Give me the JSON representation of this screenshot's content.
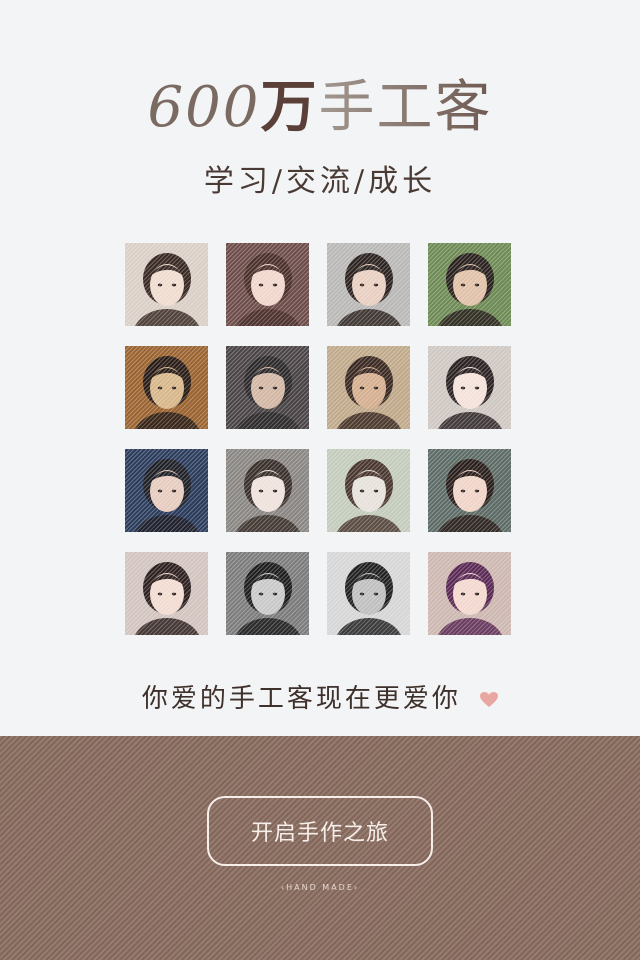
{
  "header": {
    "count": "600",
    "unit": "万",
    "name": "手工客",
    "subtitle": "学习/交流/成长"
  },
  "grid": {
    "avatars": [
      {
        "label": "avatar-1",
        "bg": "#d9cfc6",
        "skin": "#f0dccf",
        "hair": "#3a2a24"
      },
      {
        "label": "avatar-2",
        "bg": "#6d4d4a",
        "skin": "#f1d6cc",
        "hair": "#4b302b"
      },
      {
        "label": "avatar-3",
        "bg": "#b9b8b6",
        "skin": "#e8cfc1",
        "hair": "#2d2422"
      },
      {
        "label": "avatar-4",
        "bg": "#6e8a55",
        "skin": "#e1c1a8",
        "hair": "#2a221f"
      },
      {
        "label": "avatar-5",
        "bg": "#9a6330",
        "skin": "#d7b68a",
        "hair": "#2a1d17"
      },
      {
        "label": "avatar-6",
        "bg": "#4b4446",
        "skin": "#d3b7a5",
        "hair": "#2d2a2b"
      },
      {
        "label": "avatar-7",
        "bg": "#c0a98a",
        "skin": "#d4ae8e",
        "hair": "#3b2a22"
      },
      {
        "label": "avatar-8",
        "bg": "#cfc7c2",
        "skin": "#f4e2da",
        "hair": "#2b2324"
      },
      {
        "label": "avatar-9",
        "bg": "#2b3c5c",
        "skin": "#e6cbbf",
        "hair": "#202028"
      },
      {
        "label": "avatar-10",
        "bg": "#8a8683",
        "skin": "#efe2dc",
        "hair": "#3a302c"
      },
      {
        "label": "avatar-11",
        "bg": "#c3ccbc",
        "skin": "#e6e1da",
        "hair": "#4a3830"
      },
      {
        "label": "avatar-12",
        "bg": "#5d6b66",
        "skin": "#f0d4c7",
        "hair": "#2a1f1b"
      },
      {
        "label": "avatar-13",
        "bg": "#d2c4bf",
        "skin": "#f2dbd1",
        "hair": "#2e2120"
      },
      {
        "label": "avatar-14",
        "bg": "#7c7c7c",
        "skin": "#c9c9c9",
        "hair": "#1e1e1e"
      },
      {
        "label": "avatar-15",
        "bg": "#d6d6d6",
        "skin": "#bfbfbf",
        "hair": "#222222"
      },
      {
        "label": "avatar-16",
        "bg": "#cdb7b0",
        "skin": "#f3d8cf",
        "hair": "#5a2a55"
      }
    ]
  },
  "tagline": "你爱的手工客现在更爱你",
  "heart_icon": "heart-icon",
  "cta": {
    "label": "开启手作之旅"
  },
  "brandmark": "HAND MADE"
}
